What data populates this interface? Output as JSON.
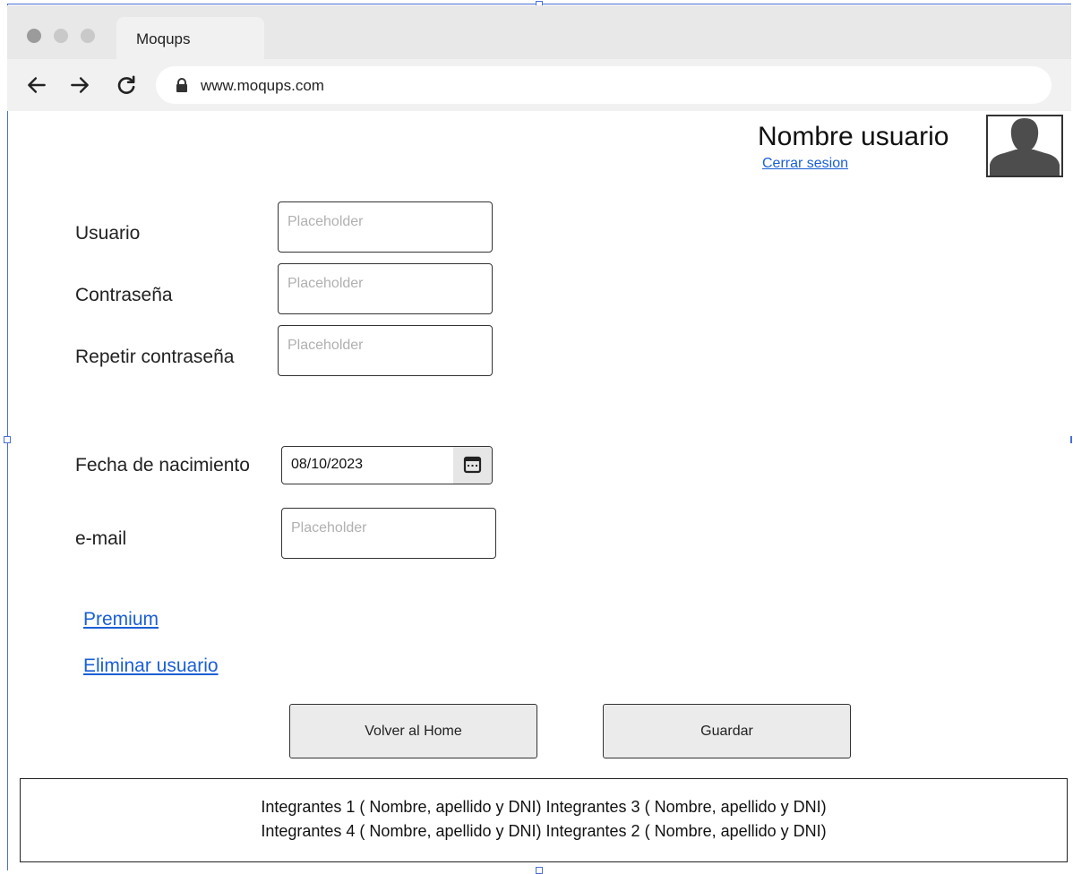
{
  "browser": {
    "tab_title": "Moqups",
    "url": "www.moqups.com",
    "traffic_lights": [
      "#9b9b9b",
      "#c9c9c9",
      "#c9c9c9"
    ]
  },
  "header": {
    "username": "Nombre usuario",
    "logout_label": "Cerrar sesion",
    "avatar_icon": "user-avatar-icon"
  },
  "form": {
    "usuario": {
      "label": "Usuario",
      "placeholder": "Placeholder"
    },
    "password": {
      "label": "Contraseña",
      "placeholder": "Placeholder"
    },
    "repeat_password": {
      "label": "Repetir contraseña",
      "placeholder": "Placeholder"
    },
    "birthdate": {
      "label": "Fecha de nacimiento",
      "value": "08/10/2023",
      "icon": "calendar-icon"
    },
    "email": {
      "label": "e-mail",
      "placeholder": "Placeholder"
    }
  },
  "links": {
    "premium": "Premium",
    "delete_user": "Eliminar usuario"
  },
  "buttons": {
    "back_home": "Volver al Home",
    "save": "Guardar"
  },
  "footer": {
    "line1": "Integrantes 1 ( Nombre, apellido y DNI) Integrantes 3 ( Nombre, apellido y DNI)",
    "line2": "Integrantes 4 ( Nombre, apellido y DNI) Integrantes 2 ( Nombre, apellido y DNI)"
  },
  "colors": {
    "link": "#1a5fd6",
    "selection_frame": "#4a6fd8"
  }
}
